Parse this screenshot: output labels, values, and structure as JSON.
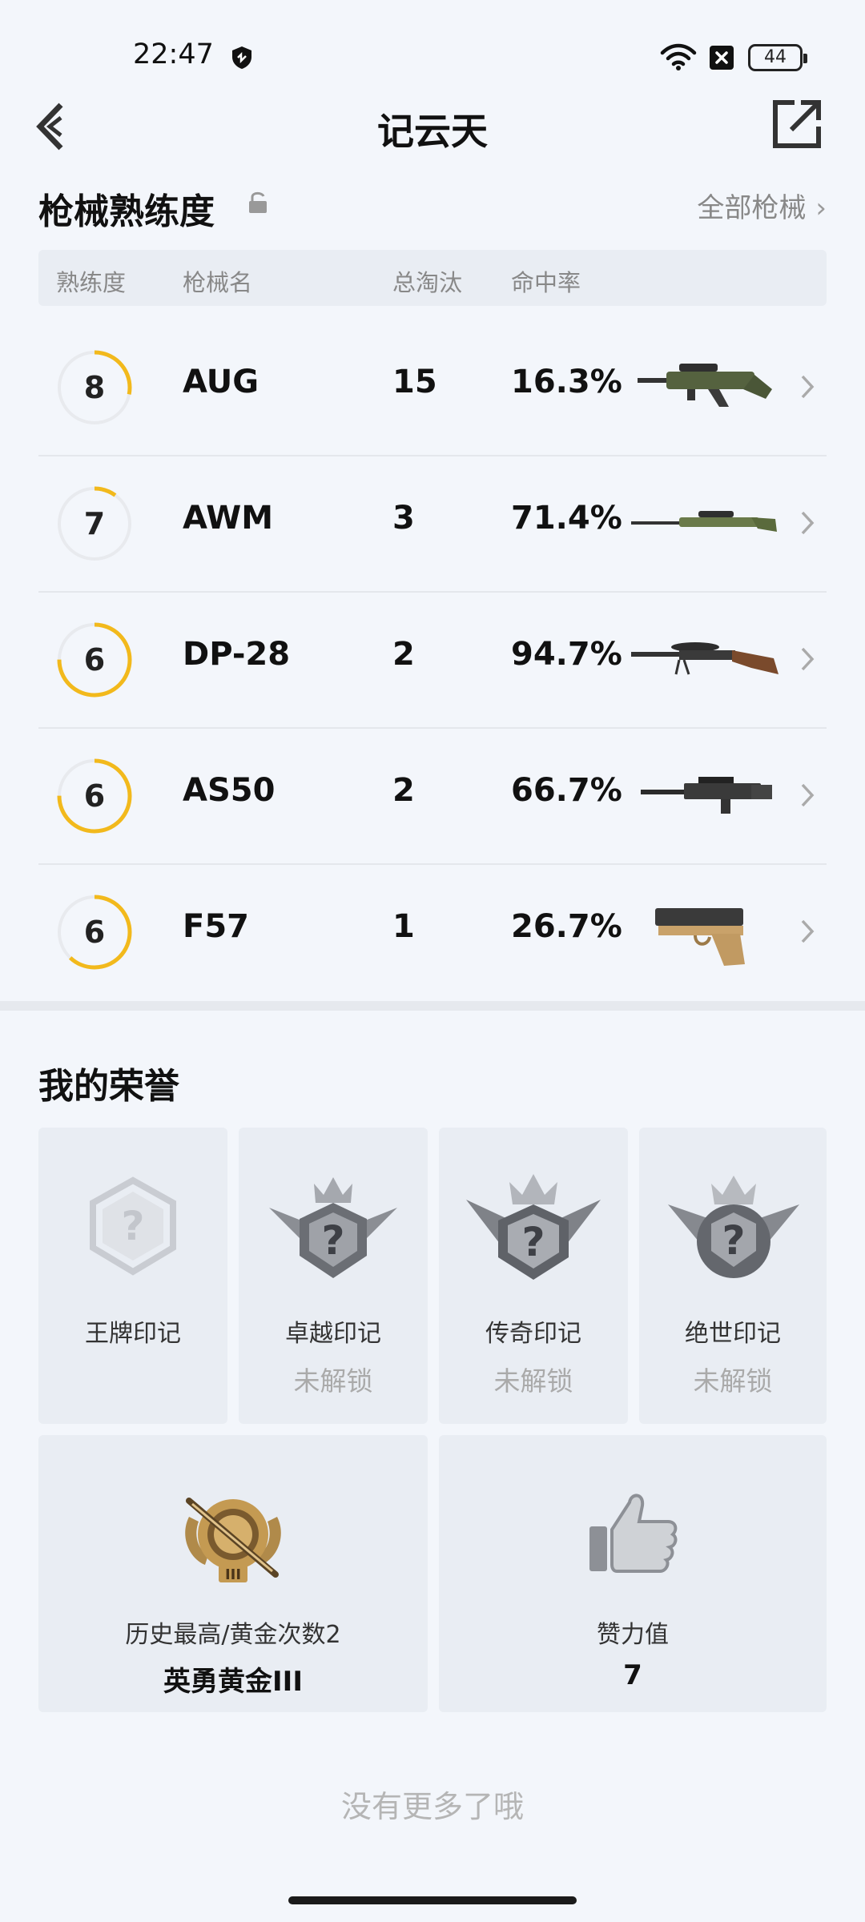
{
  "status_bar": {
    "time": "22:47",
    "battery": "44"
  },
  "header": {
    "title": "记云天"
  },
  "weapon_section": {
    "title": "枪械熟练度",
    "all_link": "全部枪械",
    "columns": [
      "熟练度",
      "枪械名",
      "总淘汰",
      "命中率"
    ],
    "rows": [
      {
        "level": "8",
        "name": "AUG",
        "kills": "15",
        "hit_rate": "16.3%",
        "progress": 0.28
      },
      {
        "level": "7",
        "name": "AWM",
        "kills": "3",
        "hit_rate": "71.4%",
        "progress": 0.1
      },
      {
        "level": "6",
        "name": "DP-28",
        "kills": "2",
        "hit_rate": "94.7%",
        "progress": 0.75
      },
      {
        "level": "6",
        "name": "AS50",
        "kills": "2",
        "hit_rate": "66.7%",
        "progress": 0.75
      },
      {
        "level": "6",
        "name": "F57",
        "kills": "1",
        "hit_rate": "26.7%",
        "progress": 0.62
      }
    ]
  },
  "honors": {
    "title": "我的荣誉",
    "marks": [
      {
        "name": "王牌印记",
        "status": ""
      },
      {
        "name": "卓越印记",
        "status": "未解锁"
      },
      {
        "name": "传奇印记",
        "status": "未解锁"
      },
      {
        "name": "绝世印记",
        "status": "未解锁"
      }
    ],
    "rank": {
      "label": "历史最高/黄金次数2",
      "value": "英勇黄金III"
    },
    "likes": {
      "label": "赞力值",
      "value": "7"
    }
  },
  "footer": {
    "note": "没有更多了哦"
  },
  "colors": {
    "ring_accent": "#f2b91c",
    "ring_track": "#e8eaee"
  }
}
